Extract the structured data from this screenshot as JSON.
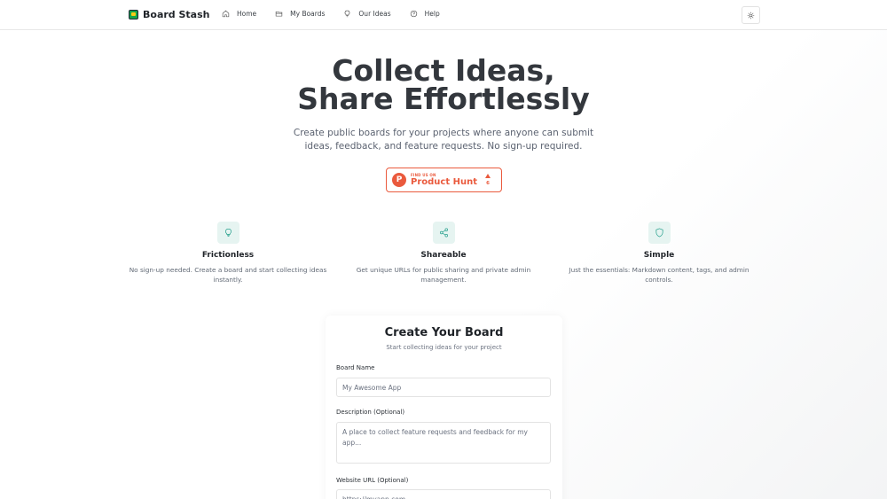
{
  "nav": {
    "brand": "Board Stash",
    "links": [
      {
        "label": "Home",
        "icon": "home-icon"
      },
      {
        "label": "My Boards",
        "icon": "folder-icon"
      },
      {
        "label": "Our Ideas",
        "icon": "lightbulb-icon"
      },
      {
        "label": "Help",
        "icon": "help-circle-icon"
      }
    ],
    "theme_icon": "sun-icon"
  },
  "hero": {
    "title_line1": "Collect Ideas,",
    "title_line2": "Share Effortlessly",
    "subtitle": "Create public boards for your projects where anyone can submit ideas, feedback, and feature requests. No sign-up required."
  },
  "product_hunt": {
    "small": "FIND US ON",
    "big": "Product Hunt",
    "logo_letter": "P",
    "count": "6"
  },
  "features": [
    {
      "title": "Frictionless",
      "desc": "No sign-up needed. Create a board and start collecting ideas instantly.",
      "icon": "lightbulb-icon"
    },
    {
      "title": "Shareable",
      "desc": "Get unique URLs for public sharing and private admin management.",
      "icon": "share-icon"
    },
    {
      "title": "Simple",
      "desc": "Just the essentials: Markdown content, tags, and admin controls.",
      "icon": "shield-icon"
    }
  ],
  "form": {
    "title": "Create Your Board",
    "subtitle": "Start collecting ideas for your project",
    "name_label": "Board Name",
    "name_placeholder": "My Awesome App",
    "desc_label": "Description (Optional)",
    "desc_placeholder": "A place to collect feature requests and feedback for my app...",
    "url_label": "Website URL (Optional)",
    "url_placeholder": "https://myapp.com"
  },
  "colors": {
    "accent": "#2ba28f",
    "product_hunt": "#ea5a3d",
    "brand_green": "#16a34a"
  }
}
